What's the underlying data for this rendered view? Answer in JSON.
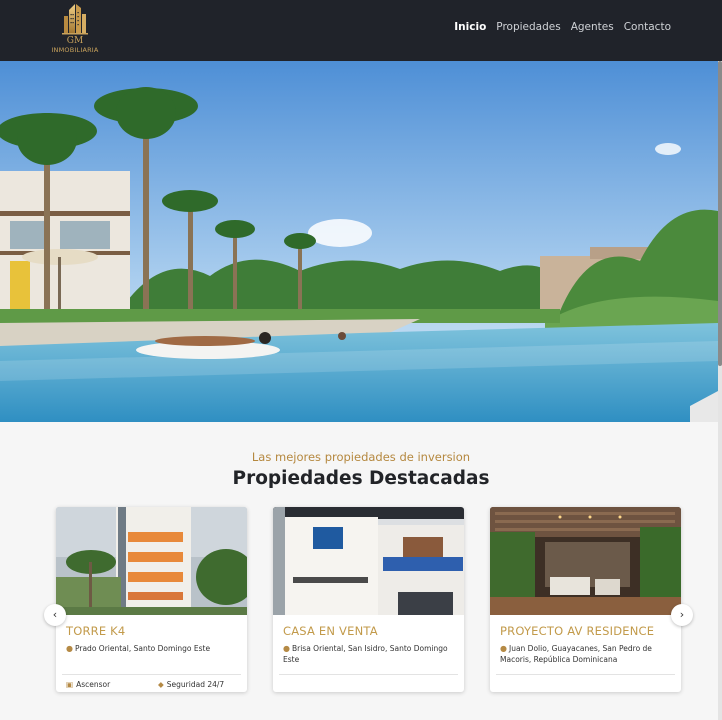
{
  "header": {
    "logo_monogram": "GM",
    "logo_text": "INMOBILIARIA",
    "nav": [
      {
        "label": "Inicio",
        "active": true
      },
      {
        "label": "Propiedades",
        "active": false
      },
      {
        "label": "Agentes",
        "active": false
      },
      {
        "label": "Contacto",
        "active": false
      }
    ]
  },
  "featured": {
    "eyebrow": "Las mejores propiedades de inversion",
    "title": "Propiedades Destacadas",
    "cards": [
      {
        "name": "TORRE K4",
        "address": "Prado Oriental, Santo Domingo Este",
        "features": [
          "Ascensor",
          "Seguridad 24/7"
        ]
      },
      {
        "name": "CASA EN VENTA",
        "address": "Brisa Oriental, San Isidro, Santo Domingo Este",
        "features": []
      },
      {
        "name": "PROYECTO AV RESIDENCE",
        "address": "Juan Dolio, Guayacanes, San Pedro de Macoris, República Dominicana",
        "features": []
      }
    ],
    "prev_glyph": "‹",
    "next_glyph": "›"
  },
  "colors": {
    "header_bg": "#20232a",
    "accent_gold": "#c29a4a",
    "title_dark": "#222428"
  }
}
